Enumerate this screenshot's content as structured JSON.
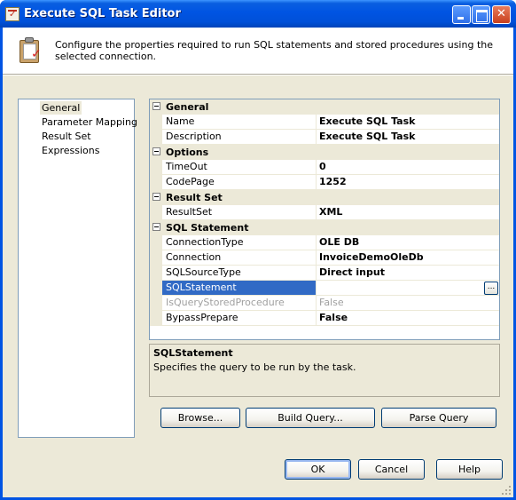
{
  "window": {
    "title": "Execute SQL Task Editor",
    "icon": "task-editor-icon"
  },
  "header": {
    "description": "Configure the properties required to run SQL statements and stored procedures using the selected connection.",
    "icon": "clipboard-check-icon"
  },
  "nav": {
    "items": [
      {
        "label": "General",
        "selected": true
      },
      {
        "label": "Parameter Mapping",
        "selected": false
      },
      {
        "label": "Result Set",
        "selected": false
      },
      {
        "label": "Expressions",
        "selected": false
      }
    ]
  },
  "properties": {
    "general": {
      "label": "General",
      "name": {
        "label": "Name",
        "value": "Execute SQL Task"
      },
      "description": {
        "label": "Description",
        "value": "Execute SQL Task"
      }
    },
    "options": {
      "label": "Options",
      "timeout": {
        "label": "TimeOut",
        "value": "0"
      },
      "codepage": {
        "label": "CodePage",
        "value": "1252"
      }
    },
    "resultset": {
      "label": "Result Set",
      "resultset": {
        "label": "ResultSet",
        "value": "XML"
      }
    },
    "sqlstatement": {
      "label": "SQL Statement",
      "connectiontype": {
        "label": "ConnectionType",
        "value": "OLE DB"
      },
      "connection": {
        "label": "Connection",
        "value": "InvoiceDemoOleDb"
      },
      "sqlsourcetype": {
        "label": "SQLSourceType",
        "value": "Direct input"
      },
      "sqlstatement": {
        "label": "SQLStatement",
        "value": "",
        "button": "..."
      },
      "isquerystoredprocedure": {
        "label": "IsQueryStoredProcedure",
        "value": "False"
      },
      "bypassprepare": {
        "label": "BypassPrepare",
        "value": "False"
      }
    }
  },
  "description_panel": {
    "title": "SQLStatement",
    "text": "Specifies the query to be run by the task."
  },
  "buttons": {
    "browse": "Browse...",
    "build_query": "Build Query...",
    "parse_query": "Parse Query",
    "ok": "OK",
    "cancel": "Cancel",
    "help": "Help"
  },
  "colors": {
    "titlebar": "#0054e3",
    "selection": "#316ac5",
    "face": "#ece9d8"
  }
}
